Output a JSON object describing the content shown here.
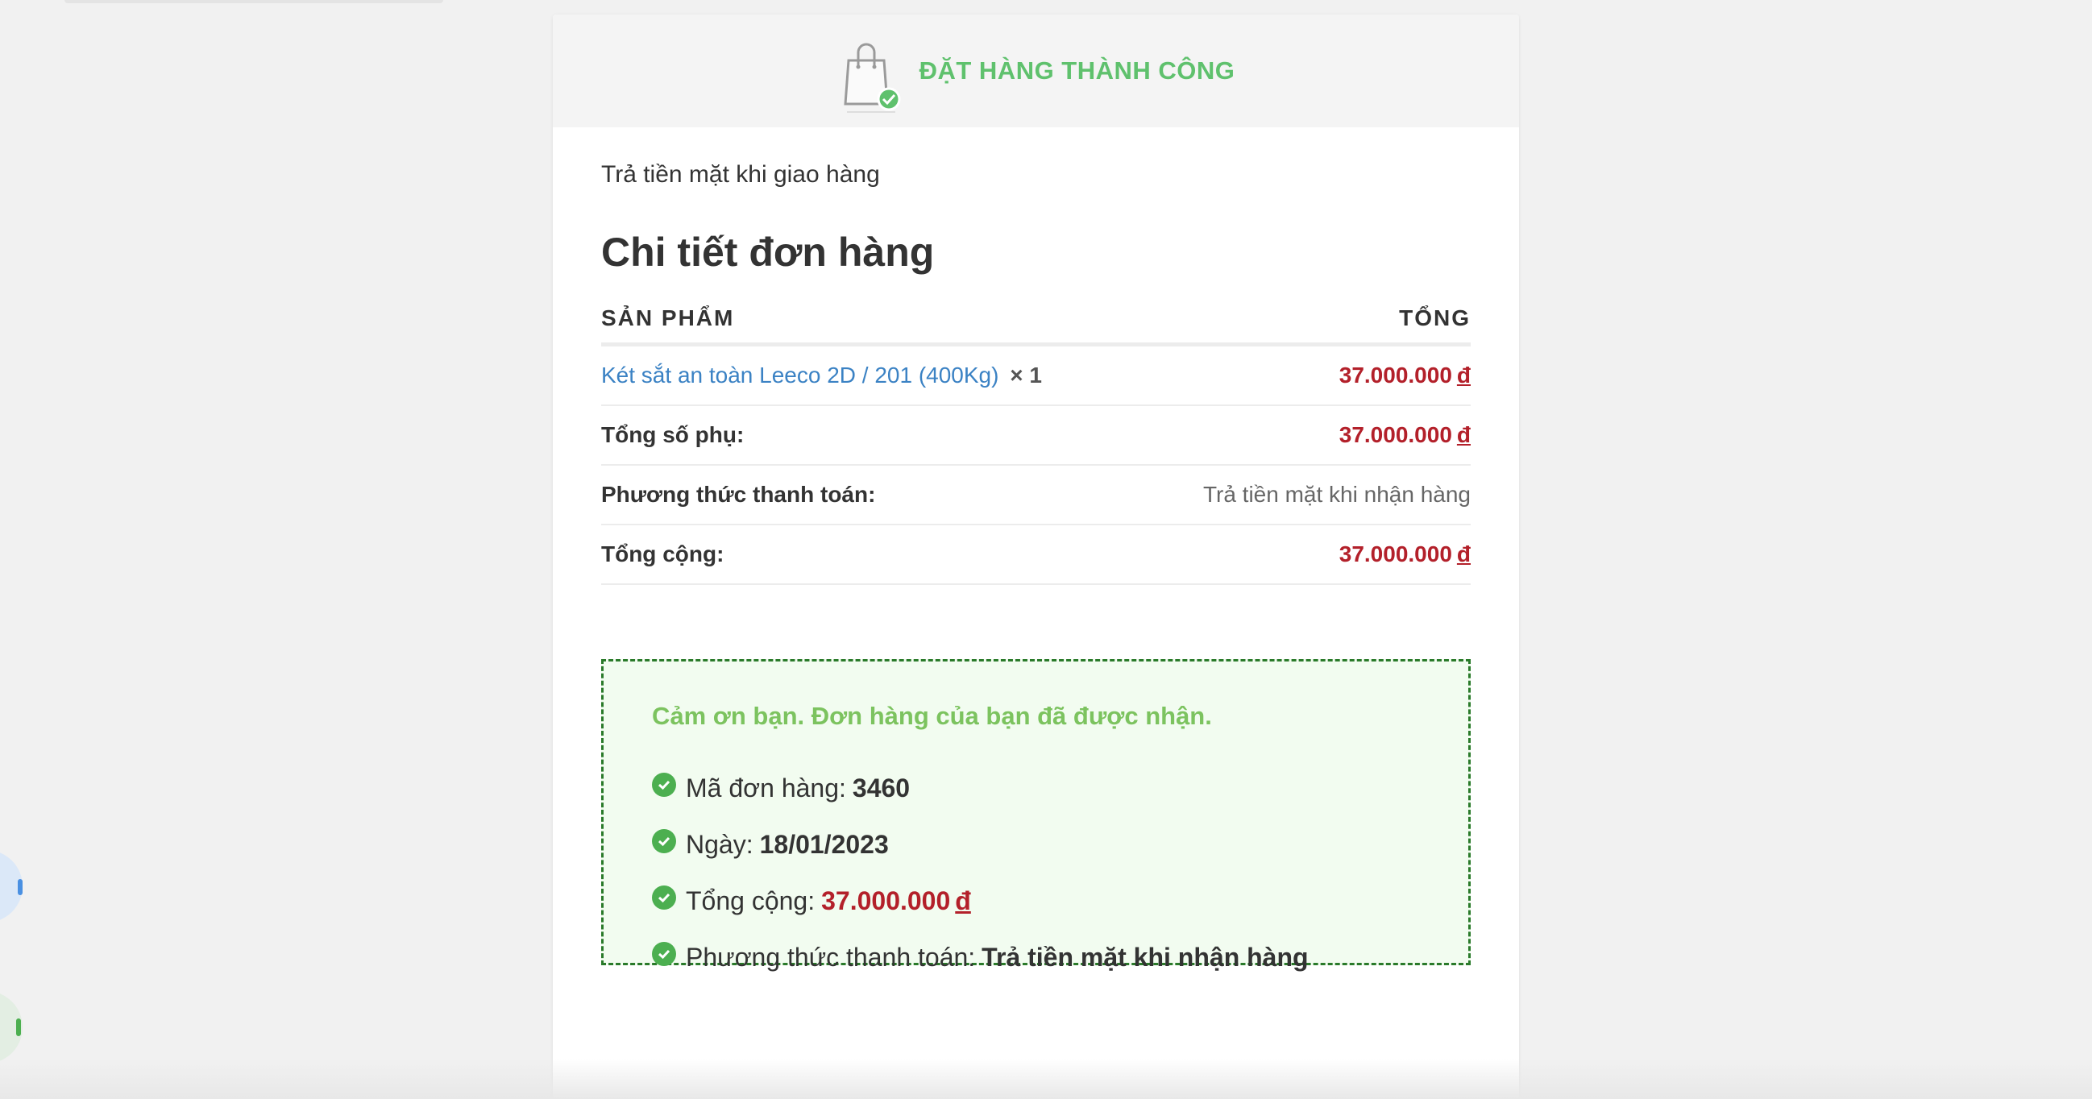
{
  "header": {
    "title": "ĐẶT HÀNG THÀNH CÔNG",
    "icon": "shopping-bag-check-icon"
  },
  "payment_note": "Trả tiền mặt khi giao hàng",
  "details": {
    "heading": "Chi tiết đơn hàng",
    "col_product": "SẢN PHẨM",
    "col_total": "TỔNG",
    "product": {
      "name": "Két sắt an toàn Leeco 2D / 201 (400Kg)",
      "qty": "× 1",
      "price": "37.000.000",
      "currency": "đ"
    },
    "subtotal": {
      "label": "Tổng số phụ:",
      "value": "37.000.000",
      "currency": "đ"
    },
    "payment_method": {
      "label": "Phương thức thanh toán:",
      "value": "Trả tiền mặt khi nhận hàng"
    },
    "grand_total": {
      "label": "Tổng cộng:",
      "value": "37.000.000",
      "currency": "đ"
    }
  },
  "thanks": {
    "message": "Cảm ơn bạn. Đơn hàng của bạn đã được nhận.",
    "order_no_label": "Mã đơn hàng:",
    "order_no": "3460",
    "date_label": "Ngày:",
    "date": "18/01/2023",
    "total_label": "Tổng cộng:",
    "total": "37.000.000",
    "currency": "đ",
    "method_label": "Phương thức thanh toán:",
    "method": "Trả tiền mặt khi nhận hàng"
  },
  "colors": {
    "success": "#5fc16d",
    "price": "#b3202a",
    "link": "#3b82c4",
    "box_border": "#2a7a2a",
    "box_bg": "#f2fcf0"
  }
}
